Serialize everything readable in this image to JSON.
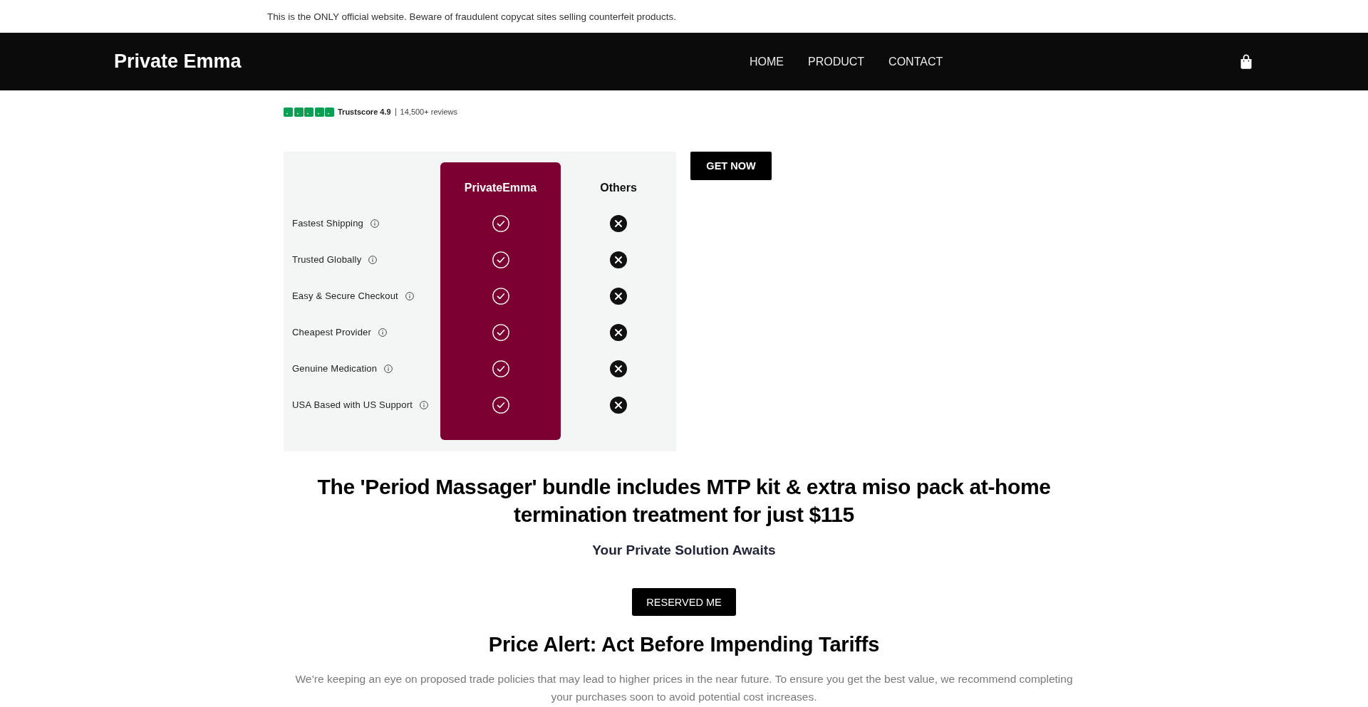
{
  "announcement": "This is the ONLY official website. Beware of fraudulent copycat sites selling counterfeit products.",
  "header": {
    "logo": "Private Emma",
    "nav": [
      {
        "label": "HOME"
      },
      {
        "label": "PRODUCT"
      },
      {
        "label": "CONTACT"
      }
    ]
  },
  "trust": {
    "stars": 5,
    "score": "Trustscore 4.9",
    "reviews": "14,500+ reviews"
  },
  "comparison": {
    "columns": [
      {
        "label": "PrivateEmma",
        "highlighted": true
      },
      {
        "label": "Others",
        "highlighted": false
      }
    ],
    "rows": [
      {
        "feature": "Fastest Shipping",
        "cells": [
          {
            "checked": true
          },
          {
            "checked": false
          }
        ]
      },
      {
        "feature": "Trusted Globally",
        "cells": [
          {
            "checked": true
          },
          {
            "checked": false
          }
        ]
      },
      {
        "feature": "Easy & Secure Checkout",
        "cells": [
          {
            "checked": true
          },
          {
            "checked": false
          }
        ]
      },
      {
        "feature": "Cheapest Provider",
        "cells": [
          {
            "checked": true
          },
          {
            "checked": false
          }
        ]
      },
      {
        "feature": "Genuine Medication",
        "cells": [
          {
            "checked": true
          },
          {
            "checked": false
          }
        ]
      },
      {
        "feature": "USA Based with US Support",
        "cells": [
          {
            "checked": true
          },
          {
            "checked": false
          }
        ]
      }
    ]
  },
  "get_now_button": "GET NOW",
  "offer": {
    "heading": "The 'Period Massager' bundle includes MTP kit & extra miso pack at-home termination treatment for just $115",
    "subheading": "Your Private Solution Awaits",
    "button": "RESERVED ME"
  },
  "price_alert": {
    "heading": "Price Alert: Act Before Impending Tariffs",
    "text": "We’re keeping an eye on proposed trade policies that may lead to higher prices in the near future. To ensure you get the best value, we recommend completing your purchases soon to avoid potential cost increases."
  }
}
